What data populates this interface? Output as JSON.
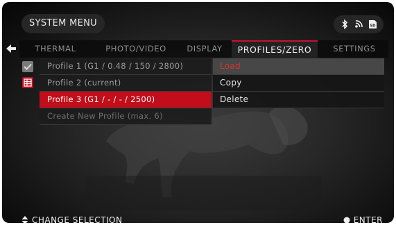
{
  "header": {
    "title": "SYSTEM MENU",
    "status_icons": [
      "bluetooth-icon",
      "wifi-icon",
      "sd-card-icon"
    ],
    "sd_label": "SD"
  },
  "tabs": [
    {
      "label": "THERMAL",
      "active": false
    },
    {
      "label": "PHOTO/VIDEO",
      "active": false
    },
    {
      "label": "DISPLAY",
      "active": false
    },
    {
      "label": "PROFILES/ZERO",
      "active": true
    },
    {
      "label": "SETTINGS",
      "active": false
    }
  ],
  "profiles": [
    {
      "label": "Profile 1 (G1 / 0.48 / 150 / 2800)",
      "state": "normal"
    },
    {
      "label": "Profile 2 (current)",
      "state": "normal"
    },
    {
      "label": "Profile 3 (G1 / - / - / 2500)",
      "state": "selected"
    },
    {
      "label": "Create New Profile (max. 6)",
      "state": "dim"
    }
  ],
  "context_menu": [
    {
      "label": "Load",
      "selected": true
    },
    {
      "label": "Copy",
      "selected": false
    },
    {
      "label": "Delete",
      "selected": false
    }
  ],
  "footer": {
    "left_hint": "CHANGE SELECTION",
    "right_hint": "ENTER"
  },
  "colors": {
    "accent": "#c20d1a",
    "menu_highlight": "#474747",
    "menu_highlight_text": "#d9322c"
  }
}
